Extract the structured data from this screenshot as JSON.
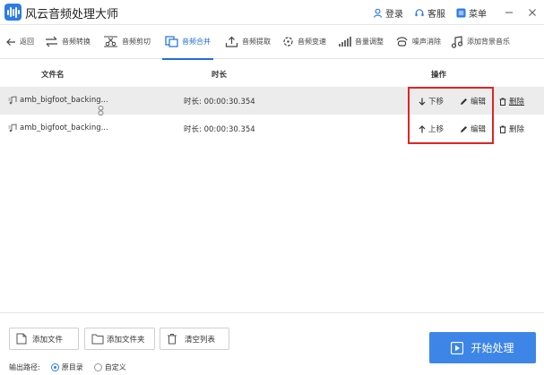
{
  "app": {
    "title": "风云音频处理大师"
  },
  "titlebar": {
    "login": "登录",
    "service": "客服",
    "menu": "菜单"
  },
  "toolbar": {
    "back": "返回",
    "tools": [
      "音频转换",
      "音频剪切",
      "音频合并",
      "音频提取",
      "音频变速",
      "音量调整",
      "噪声消除",
      "添加背景音乐"
    ],
    "active_tool": "音频合并"
  },
  "table": {
    "headers": {
      "file": "文件名",
      "duration": "时长",
      "actions": "操作"
    },
    "rows": [
      {
        "name": "amb_bigfoot_backing...",
        "duration_label": "时长:",
        "duration": "00:00:30.354",
        "move": "下移",
        "edit": "编辑",
        "delete": "删除"
      },
      {
        "name": "amb_bigfoot_backing...",
        "duration_label": "时长:",
        "duration": "00:00:30.354",
        "move": "上移",
        "edit": "编辑",
        "delete": "删除"
      }
    ]
  },
  "bottom": {
    "add_file": "添加文件",
    "add_folder": "添加文件夹",
    "clear_list": "清空列表",
    "start": "开始处理",
    "output_label": "输出路径:",
    "output_options": [
      "原目录",
      "自定义"
    ],
    "selected_output": "原目录"
  },
  "colors": {
    "accent": "#1c6fd9",
    "start_button": "#3d86e8",
    "highlight_box": "#e02424",
    "selected_row": "#ececec"
  }
}
